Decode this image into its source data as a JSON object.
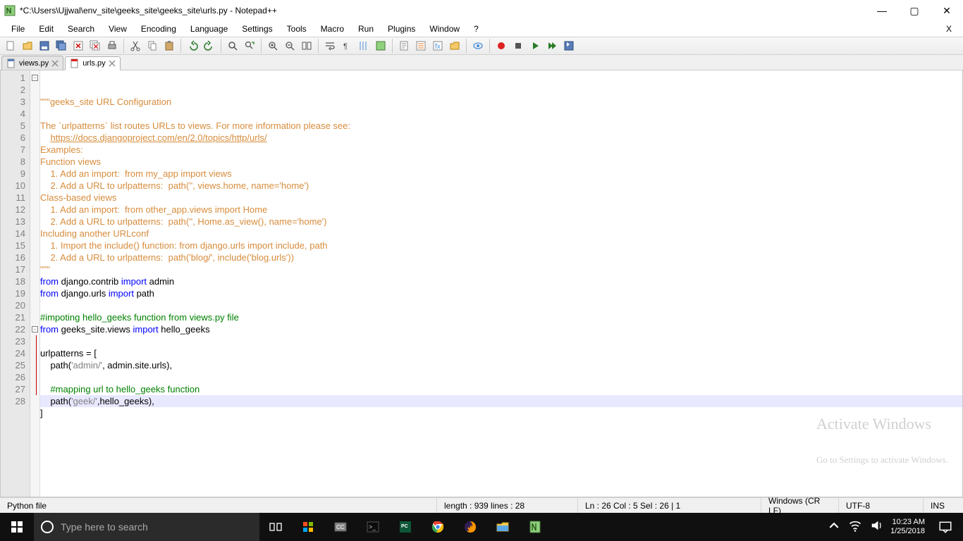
{
  "window": {
    "title": "*C:\\Users\\Ujjwal\\env_site\\geeks_site\\geeks_site\\urls.py - Notepad++",
    "min": "—",
    "max": "▢",
    "close": "✕",
    "secondary_close": "X"
  },
  "menu": {
    "items": [
      "File",
      "Edit",
      "Search",
      "View",
      "Encoding",
      "Language",
      "Settings",
      "Tools",
      "Macro",
      "Run",
      "Plugins",
      "Window",
      "?"
    ]
  },
  "tabs": {
    "items": [
      {
        "label": "views.py",
        "active": false,
        "dirty": false
      },
      {
        "label": "urls.py",
        "active": true,
        "dirty": true
      }
    ]
  },
  "code": {
    "lines": [
      {
        "n": 1,
        "frag": [
          {
            "c": "c-doc",
            "t": "\"\"\"geeks_site URL Configuration"
          }
        ],
        "fold": "open"
      },
      {
        "n": 2,
        "frag": [
          {
            "c": "c-doc",
            "t": ""
          }
        ]
      },
      {
        "n": 3,
        "frag": [
          {
            "c": "c-doc",
            "t": "The `urlpatterns` list routes URLs to views. For more information please see:"
          }
        ]
      },
      {
        "n": 4,
        "frag": [
          {
            "c": "c-doc",
            "t": "    "
          },
          {
            "c": "c-link",
            "t": "https://docs.djangoproject.com/en/2.0/topics/http/urls/"
          }
        ]
      },
      {
        "n": 5,
        "frag": [
          {
            "c": "c-doc",
            "t": "Examples:"
          }
        ]
      },
      {
        "n": 6,
        "frag": [
          {
            "c": "c-doc",
            "t": "Function views"
          }
        ]
      },
      {
        "n": 7,
        "frag": [
          {
            "c": "c-doc",
            "t": "    1. Add an import:  from my_app import views"
          }
        ]
      },
      {
        "n": 8,
        "frag": [
          {
            "c": "c-doc",
            "t": "    2. Add a URL to urlpatterns:  path('', views.home, name='home')"
          }
        ]
      },
      {
        "n": 9,
        "frag": [
          {
            "c": "c-doc",
            "t": "Class-based views"
          }
        ]
      },
      {
        "n": 10,
        "frag": [
          {
            "c": "c-doc",
            "t": "    1. Add an import:  from other_app.views import Home"
          }
        ]
      },
      {
        "n": 11,
        "frag": [
          {
            "c": "c-doc",
            "t": "    2. Add a URL to urlpatterns:  path('', Home.as_view(), name='home')"
          }
        ]
      },
      {
        "n": 12,
        "frag": [
          {
            "c": "c-doc",
            "t": "Including another URLconf"
          }
        ]
      },
      {
        "n": 13,
        "frag": [
          {
            "c": "c-doc",
            "t": "    1. Import the include() function: from django.urls import include, path"
          }
        ]
      },
      {
        "n": 14,
        "frag": [
          {
            "c": "c-doc",
            "t": "    2. Add a URL to urlpatterns:  path('blog/', include('blog.urls'))"
          }
        ]
      },
      {
        "n": 15,
        "frag": [
          {
            "c": "c-doc",
            "t": "\"\"\""
          }
        ]
      },
      {
        "n": 16,
        "frag": [
          {
            "c": "c-kw",
            "t": "from"
          },
          {
            "c": "c-def",
            "t": " django.contrib "
          },
          {
            "c": "c-kw",
            "t": "import"
          },
          {
            "c": "c-def",
            "t": " admin"
          }
        ]
      },
      {
        "n": 17,
        "frag": [
          {
            "c": "c-kw",
            "t": "from"
          },
          {
            "c": "c-def",
            "t": " django.urls "
          },
          {
            "c": "c-kw",
            "t": "import"
          },
          {
            "c": "c-def",
            "t": " path"
          }
        ]
      },
      {
        "n": 18,
        "frag": []
      },
      {
        "n": 19,
        "frag": [
          {
            "c": "c-comment",
            "t": "#impoting hello_geeks function from views.py file"
          }
        ]
      },
      {
        "n": 20,
        "frag": [
          {
            "c": "c-kw",
            "t": "from"
          },
          {
            "c": "c-def",
            "t": " geeks_site.views "
          },
          {
            "c": "c-kw",
            "t": "import"
          },
          {
            "c": "c-def",
            "t": " hello_geeks"
          }
        ]
      },
      {
        "n": 21,
        "frag": []
      },
      {
        "n": 22,
        "frag": [
          {
            "c": "c-def",
            "t": "urlpatterns "
          },
          {
            "c": "c-op",
            "t": "="
          },
          {
            "c": "c-def",
            "t": " ["
          }
        ],
        "fold": "open"
      },
      {
        "n": 23,
        "frag": [
          {
            "c": "c-def",
            "t": "    path("
          },
          {
            "c": "c-str",
            "t": "'admin/'"
          },
          {
            "c": "c-def",
            "t": ", admin.site.urls),"
          }
        ],
        "fold": "child"
      },
      {
        "n": 24,
        "frag": [],
        "fold": "child"
      },
      {
        "n": 25,
        "frag": [
          {
            "c": "c-def",
            "t": "    "
          },
          {
            "c": "c-comment",
            "t": "#mapping url to hello_geeks function"
          }
        ],
        "fold": "child"
      },
      {
        "n": 26,
        "frag": [
          {
            "c": "c-def",
            "t": "    path("
          },
          {
            "c": "c-str",
            "t": "'geek/'"
          },
          {
            "c": "c-def",
            "t": ",hello_geeks),"
          }
        ],
        "hl": true,
        "fold": "child"
      },
      {
        "n": 27,
        "frag": [
          {
            "c": "c-def",
            "t": "]"
          }
        ],
        "fold": "child"
      },
      {
        "n": 28,
        "frag": []
      }
    ]
  },
  "watermark": {
    "line1": "Activate Windows",
    "line2": "Go to Settings to activate Windows."
  },
  "status": {
    "filetype": "Python file",
    "length": "length : 939    lines : 28",
    "pos": "Ln : 26   Col : 5   Sel : 26 | 1",
    "eol": "Windows (CR LF)",
    "enc": "UTF-8",
    "ins": "INS"
  },
  "taskbar": {
    "search_placeholder": "Type here to search",
    "time": "10:23 AM",
    "date": "1/25/2018"
  },
  "colors": {
    "docstring": "#d78c3c",
    "keyword": "#0000ff",
    "comment": "#008000",
    "string": "#808080"
  }
}
